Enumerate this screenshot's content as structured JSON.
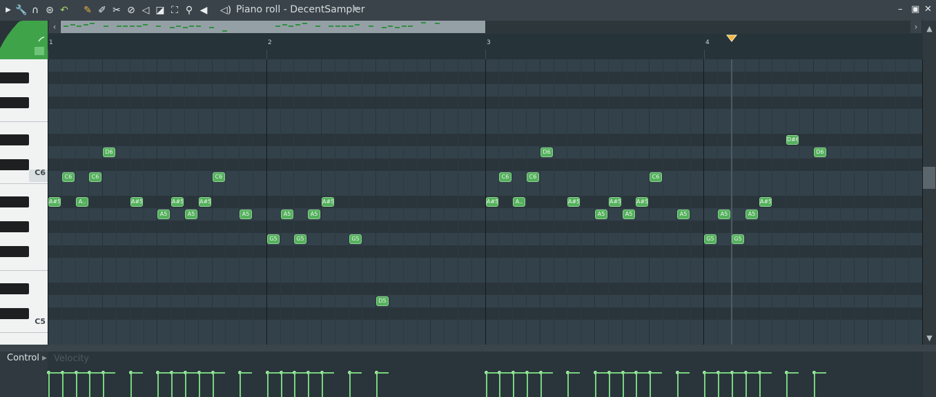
{
  "window": {
    "title": "Piano roll - DecentSampler"
  },
  "toolbar": {
    "icons": [
      "play-arrow-icon",
      "wrench-icon",
      "magnet-icon",
      "menu-circle-icon",
      "undo-icon",
      "pencil-icon",
      "paint-brush-icon",
      "delete-icon",
      "disable-icon",
      "mute-icon",
      "slice-icon",
      "select-icon",
      "zoom-icon",
      "playback-icon",
      "speaker-icon"
    ]
  },
  "ruler": {
    "bars": [
      "1",
      "2",
      "3",
      "4"
    ]
  },
  "keys": {
    "c6": "C6",
    "c5": "C5"
  },
  "control": {
    "label": "Control",
    "param": "Velocity"
  },
  "colors": {
    "note": "#55b05d",
    "note_border": "#8ed492",
    "velocity": "#7ad47f",
    "green_tab": "#3fa34a"
  },
  "notes": [
    {
      "label": "A#5",
      "pitch": "A#5",
      "bar": 1,
      "step": 1
    },
    {
      "label": "C6",
      "pitch": "C6",
      "bar": 1,
      "step": 2
    },
    {
      "label": "A..",
      "pitch": "A#5",
      "bar": 1,
      "step": 3
    },
    {
      "label": "C6",
      "pitch": "C6",
      "bar": 1,
      "step": 4
    },
    {
      "label": "D6",
      "pitch": "D6",
      "bar": 1,
      "step": 5
    },
    {
      "label": "A#5",
      "pitch": "A#5",
      "bar": 1,
      "step": 7
    },
    {
      "label": "A5",
      "pitch": "A5",
      "bar": 1,
      "step": 9
    },
    {
      "label": "A#5",
      "pitch": "A#5",
      "bar": 1,
      "step": 10
    },
    {
      "label": "A5",
      "pitch": "A5",
      "bar": 1,
      "step": 11
    },
    {
      "label": "A#5",
      "pitch": "A#5",
      "bar": 1,
      "step": 12
    },
    {
      "label": "C6",
      "pitch": "C6",
      "bar": 1,
      "step": 13
    },
    {
      "label": "A5",
      "pitch": "A5",
      "bar": 1,
      "step": 15
    },
    {
      "label": "G5",
      "pitch": "G5",
      "bar": 2,
      "step": 1
    },
    {
      "label": "A5",
      "pitch": "A5",
      "bar": 2,
      "step": 2
    },
    {
      "label": "G5",
      "pitch": "G5",
      "bar": 2,
      "step": 3
    },
    {
      "label": "A5",
      "pitch": "A5",
      "bar": 2,
      "step": 4
    },
    {
      "label": "A#5",
      "pitch": "A#5",
      "bar": 2,
      "step": 5
    },
    {
      "label": "G5",
      "pitch": "G5",
      "bar": 2,
      "step": 7
    },
    {
      "label": "D5",
      "pitch": "D5",
      "bar": 2,
      "step": 9
    },
    {
      "label": "A#5",
      "pitch": "A#5",
      "bar": 3,
      "step": 1
    },
    {
      "label": "C6",
      "pitch": "C6",
      "bar": 3,
      "step": 2
    },
    {
      "label": "A..",
      "pitch": "A#5",
      "bar": 3,
      "step": 3
    },
    {
      "label": "C6",
      "pitch": "C6",
      "bar": 3,
      "step": 4
    },
    {
      "label": "D6",
      "pitch": "D6",
      "bar": 3,
      "step": 5
    },
    {
      "label": "A#5",
      "pitch": "A#5",
      "bar": 3,
      "step": 7
    },
    {
      "label": "A5",
      "pitch": "A5",
      "bar": 3,
      "step": 9
    },
    {
      "label": "A#5",
      "pitch": "A#5",
      "bar": 3,
      "step": 10
    },
    {
      "label": "A5",
      "pitch": "A5",
      "bar": 3,
      "step": 11
    },
    {
      "label": "A#5",
      "pitch": "A#5",
      "bar": 3,
      "step": 12
    },
    {
      "label": "C6",
      "pitch": "C6",
      "bar": 3,
      "step": 13
    },
    {
      "label": "A5",
      "pitch": "A5",
      "bar": 3,
      "step": 15
    },
    {
      "label": "G5",
      "pitch": "G5",
      "bar": 4,
      "step": 1
    },
    {
      "label": "A5",
      "pitch": "A5",
      "bar": 4,
      "step": 2
    },
    {
      "label": "G5",
      "pitch": "G5",
      "bar": 4,
      "step": 3
    },
    {
      "label": "A5",
      "pitch": "A5",
      "bar": 4,
      "step": 4
    },
    {
      "label": "A#5",
      "pitch": "A#5",
      "bar": 4,
      "step": 5
    },
    {
      "label": "D#6",
      "pitch": "D#6",
      "bar": 4,
      "step": 7
    },
    {
      "label": "D6",
      "pitch": "D6",
      "bar": 4,
      "step": 9
    }
  ]
}
